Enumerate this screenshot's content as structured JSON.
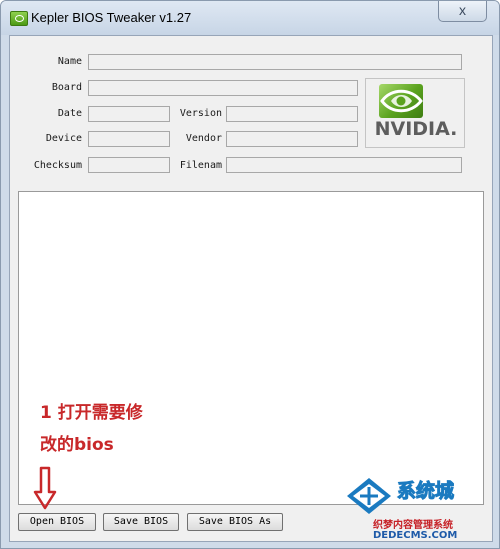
{
  "window": {
    "title": "Kepler BIOS Tweaker v1.27",
    "close_label": "x"
  },
  "fields": {
    "name": {
      "label": "Name",
      "value": ""
    },
    "board": {
      "label": "Board",
      "value": ""
    },
    "date": {
      "label": "Date",
      "value": ""
    },
    "version": {
      "label": "Version",
      "value": ""
    },
    "device": {
      "label": "Device",
      "value": ""
    },
    "vendor": {
      "label": "Vendor",
      "value": ""
    },
    "checksum": {
      "label": "Checksum",
      "value": ""
    },
    "filename": {
      "label": "Filenam",
      "value": ""
    }
  },
  "logo": {
    "text": "NVIDIA."
  },
  "annotation": {
    "line1": "1 打开需要修",
    "line2": "改的bios"
  },
  "buttons": {
    "open": "Open BIOS",
    "save": "Save BIOS",
    "save_as": "Save BIOS As"
  },
  "watermark": {
    "text": "系统城",
    "line1": "织梦内容管理系统",
    "line2": "DEDECMS.COM"
  },
  "colors": {
    "annotation": "#c8282a",
    "nvidia_green": "#76b900"
  }
}
